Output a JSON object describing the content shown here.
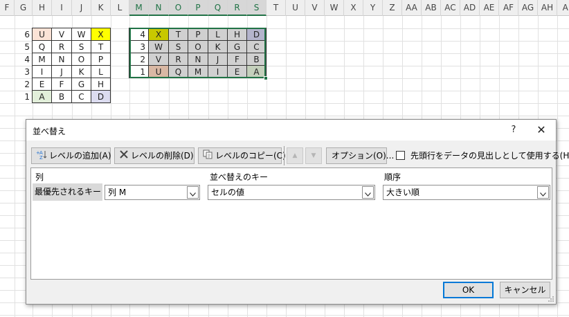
{
  "sheet": {
    "columns": [
      "F",
      "G",
      "H",
      "I",
      "J",
      "K",
      "L",
      "M",
      "N",
      "O",
      "P",
      "Q",
      "R",
      "S",
      "T",
      "U",
      "V",
      "W",
      "X",
      "Y",
      "Z",
      "AA",
      "AB",
      "AC",
      "AD",
      "AE",
      "AF",
      "AG",
      "AH",
      "AI"
    ],
    "selected_columns": [
      "M",
      "N",
      "O",
      "P",
      "Q",
      "R",
      "S"
    ],
    "left_table": {
      "row_numbers": [
        "6",
        "5",
        "4",
        "3",
        "2",
        "1"
      ],
      "rows": [
        [
          "U",
          "V",
          "W",
          "X"
        ],
        [
          "Q",
          "R",
          "S",
          "T"
        ],
        [
          "M",
          "N",
          "O",
          "P"
        ],
        [
          "I",
          "J",
          "K",
          "L"
        ],
        [
          "E",
          "F",
          "G",
          "H"
        ],
        [
          "A",
          "B",
          "C",
          "D"
        ]
      ]
    },
    "right_table": {
      "rows": [
        [
          "4",
          "X",
          "T",
          "P",
          "L",
          "H",
          "D"
        ],
        [
          "3",
          "W",
          "S",
          "O",
          "K",
          "G",
          "C"
        ],
        [
          "2",
          "V",
          "R",
          "N",
          "J",
          "F",
          "B"
        ],
        [
          "1",
          "U",
          "Q",
          "M",
          "I",
          "E",
          "A"
        ]
      ]
    },
    "colors": {
      "yellow": "#ffff00",
      "olive": "#c8c800",
      "peach": "#fbe3d6",
      "brown_peach": "#d9b8a4",
      "green_pale": "#e2efda",
      "lavender": "#dcdcf0",
      "lavender_dark": "#b4b4cc",
      "sel_gray": "#d0d0d0",
      "accent": "#217346"
    }
  },
  "dialog": {
    "title": "並べ替え",
    "help": "?",
    "close": "✕",
    "toolbar": {
      "add_level": "レベルの追加(A)",
      "delete_level": "レベルの削除(D)",
      "copy_level": "レベルのコピー(C)",
      "options": "オプション(O)...",
      "header_checkbox_label": "先頭行をデータの見出しとして使用する(H)"
    },
    "grid": {
      "headers": {
        "column": "列",
        "sort_on": "並べ替えのキー",
        "order": "順序"
      },
      "row": {
        "label": "最優先されるキー",
        "column_value": "列 M",
        "sort_on_value": "セルの値",
        "order_value": "大きい順"
      }
    },
    "ok": "OK",
    "cancel": "キャンセル"
  }
}
